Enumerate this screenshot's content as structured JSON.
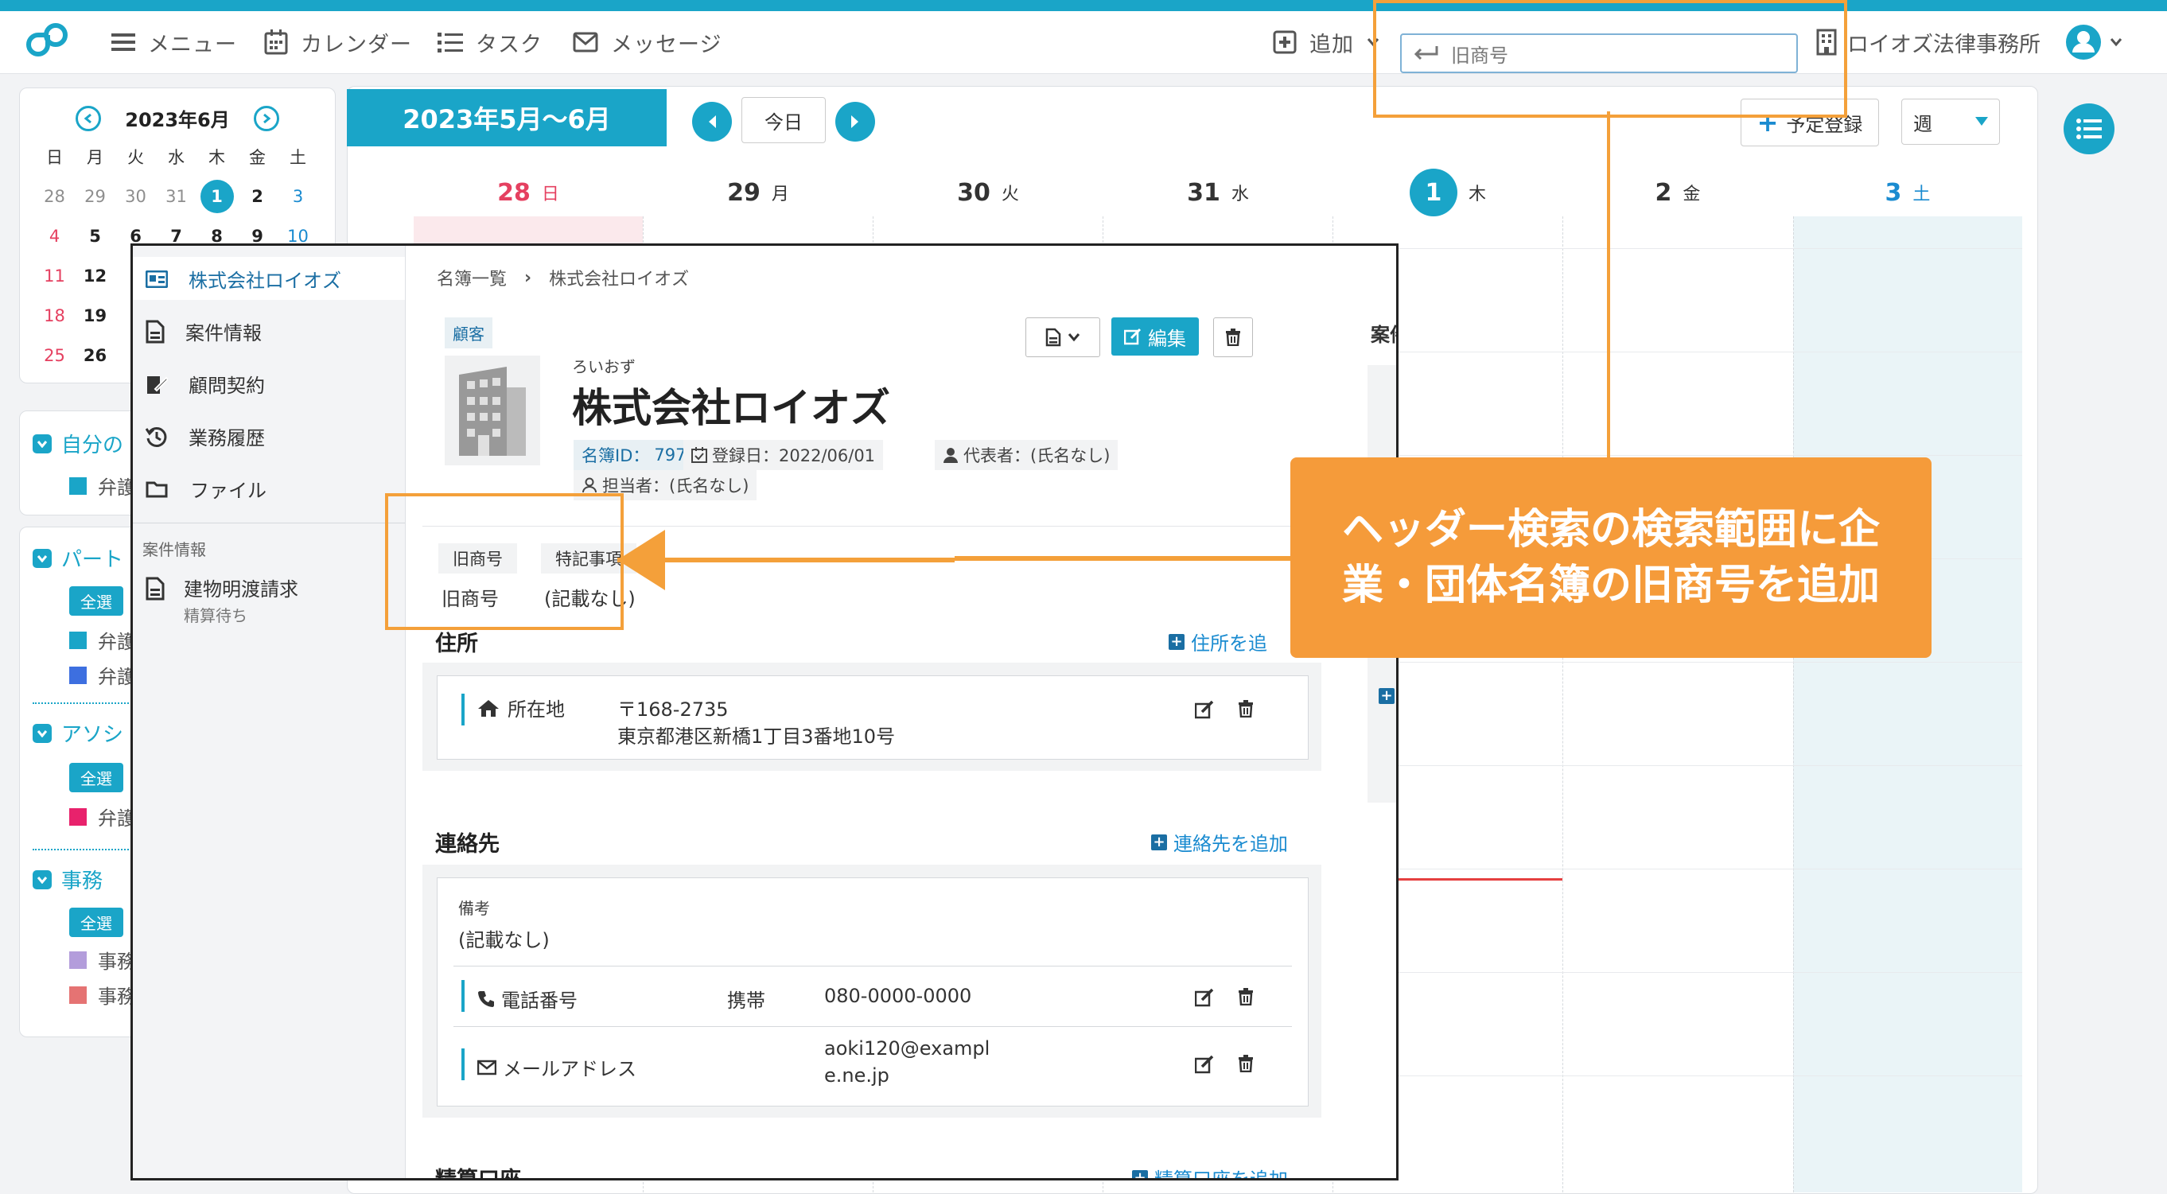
{
  "header": {
    "nav": [
      {
        "label": "メニュー",
        "icon": "hamburger-icon"
      },
      {
        "label": "カレンダー",
        "icon": "calendar-icon"
      },
      {
        "label": "タスク",
        "icon": "task-list-icon"
      },
      {
        "label": "メッセージ",
        "icon": "envelope-icon"
      }
    ],
    "add_label": "追加",
    "search_value": "旧商号",
    "org_name": "ロイオズ法律事務所"
  },
  "mini_calendar": {
    "title": "2023年6月",
    "weekdays": [
      "日",
      "月",
      "火",
      "水",
      "木",
      "金",
      "土"
    ],
    "weeks": [
      [
        "28",
        "29",
        "30",
        "31",
        "1",
        "2",
        "3"
      ],
      [
        "4",
        "5",
        "6",
        "7",
        "8",
        "9",
        "10"
      ],
      [
        "11",
        "12",
        "",
        "",
        "",
        "",
        ""
      ],
      [
        "18",
        "19",
        "",
        "",
        "",
        "",
        ""
      ],
      [
        "25",
        "26",
        "",
        "",
        "",
        "",
        ""
      ]
    ],
    "today": "1"
  },
  "sidebar_groups": [
    {
      "title": "自分の",
      "items": [
        {
          "label": "弁護",
          "color": "#1aa5c8"
        }
      ]
    },
    {
      "title": "パート",
      "select_all": "全選",
      "items": [
        {
          "label": "弁護",
          "color": "#1aa5c8"
        },
        {
          "label": "弁護",
          "color": "#3d6fe0"
        }
      ]
    },
    {
      "title": "アソシ",
      "select_all": "全選",
      "items": [
        {
          "label": "弁護",
          "color": "#e8226c"
        }
      ]
    },
    {
      "title": "事務",
      "select_all": "全選",
      "items": [
        {
          "label": "事務",
          "color": "#b39ddb"
        },
        {
          "label": "事務",
          "color": "#e57373"
        }
      ]
    }
  ],
  "calendar": {
    "period": "2023年5月～6月",
    "today_label": "今日",
    "register_label": "予定登録",
    "view_label": "週",
    "days": [
      {
        "num": "28",
        "dow": "日",
        "kind": "sun"
      },
      {
        "num": "29",
        "dow": "月",
        "kind": "normal"
      },
      {
        "num": "30",
        "dow": "火",
        "kind": "normal"
      },
      {
        "num": "31",
        "dow": "水",
        "kind": "normal"
      },
      {
        "num": "1",
        "dow": "木",
        "kind": "today"
      },
      {
        "num": "2",
        "dow": "金",
        "kind": "normal"
      },
      {
        "num": "3",
        "dow": "土",
        "kind": "sat"
      }
    ]
  },
  "panel": {
    "menu": [
      {
        "label": "株式会社ロイオズ",
        "icon": "id-card-icon"
      },
      {
        "label": "案件情報",
        "icon": "document-icon"
      },
      {
        "label": "顧問契約",
        "icon": "contract-icon"
      },
      {
        "label": "業務履歴",
        "icon": "history-icon"
      },
      {
        "label": "ファイル",
        "icon": "folder-icon"
      }
    ],
    "case_section_label": "案件情報",
    "case_item": {
      "title": "建物明渡請求",
      "status": "精算待ち"
    },
    "breadcrumb": {
      "parent": "名簿一覧",
      "current": "株式会社ロイオズ"
    },
    "type_tag": "顧客",
    "kana": "ろいおず",
    "company_name": "株式会社ロイオズ",
    "meta": {
      "id_label": "名簿ID：",
      "id_value": "797",
      "registered": "登録日：2022/06/01",
      "representative": "代表者：(氏名なし)",
      "assignee": "担当者：(氏名なし)"
    },
    "edit_label": "編集",
    "right_cut_label": "案件",
    "fields": [
      {
        "label": "旧商号",
        "value": "旧商号"
      },
      {
        "label": "特記事項",
        "value": "(記載なし)"
      }
    ],
    "address": {
      "title": "住所",
      "add_label": "住所を追",
      "type": "所在地",
      "postal": "〒168-2735",
      "line": "東京都港区新橋1丁目3番地10号"
    },
    "contact": {
      "title": "連絡先",
      "add_label": "連絡先を追加",
      "note_label": "備考",
      "note_value": "(記載なし)",
      "phone_label": "電話番号",
      "phone_type": "携帯",
      "phone_value": "080-0000-0000",
      "email_label": "メールアドレス",
      "email_line1": "aoki120@exampl",
      "email_line2": "e.ne.jp"
    },
    "account": {
      "title": "精算口座",
      "add_label": "精算口座を追加"
    }
  },
  "annotation": {
    "lines": [
      "ヘッダー検索の検索範囲に企",
      "業・団体名簿の旧商号を追加"
    ]
  },
  "colors": {
    "accent": "#1aa5c8",
    "callout": "#f59b3a"
  }
}
